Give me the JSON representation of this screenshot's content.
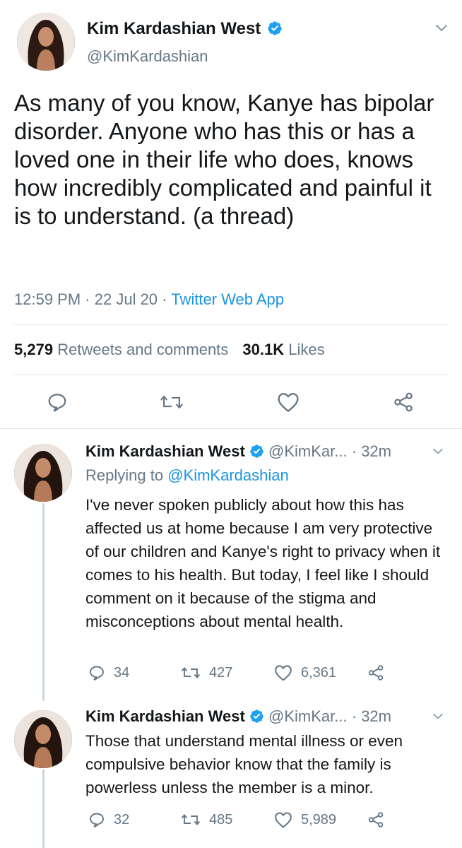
{
  "main_tweet": {
    "display_name": "Kim Kardashian West",
    "handle": "@KimKardashian",
    "text": "As many of you know, Kanye has bipolar disorder. Anyone who has this or has a loved one in their life who does, knows how incredibly complicated and painful it is to understand. (a thread)",
    "time": "12:59 PM",
    "date": "22 Jul 20",
    "source": "Twitter Web App",
    "retweets_count": "5,279",
    "retweets_label": "Retweets and comments",
    "likes_count": "30.1K",
    "likes_label": "Likes"
  },
  "replies": [
    {
      "display_name": "Kim Kardashian West",
      "handle": "@KimKar...",
      "time": "· 32m",
      "replying_to_label": "Replying to",
      "replying_to_handle": "@KimKardashian",
      "text": "I've never spoken publicly about how this has affected us at home because I am very protective of our children and Kanye's right to privacy when it comes to his health. But today, I feel like I should comment on it because of the stigma and misconceptions about mental health.",
      "reply_count": "34",
      "retweet_count": "427",
      "like_count": "6,361"
    },
    {
      "display_name": "Kim Kardashian West",
      "handle": "@KimKar...",
      "time": "· 32m",
      "text": "Those that understand mental illness or even compulsive behavior know that the family is powerless unless the member is a minor.",
      "reply_count": "32",
      "retweet_count": "485",
      "like_count": "5,989"
    }
  ],
  "icons": {
    "verified": "verified-badge-icon",
    "chevron": "chevron-down-icon",
    "reply": "reply-icon",
    "retweet": "retweet-icon",
    "like": "heart-icon",
    "share": "share-icon"
  },
  "colors": {
    "link": "#1b95e0",
    "muted": "#657786",
    "text": "#14171a",
    "divider": "#e1e8ed"
  }
}
